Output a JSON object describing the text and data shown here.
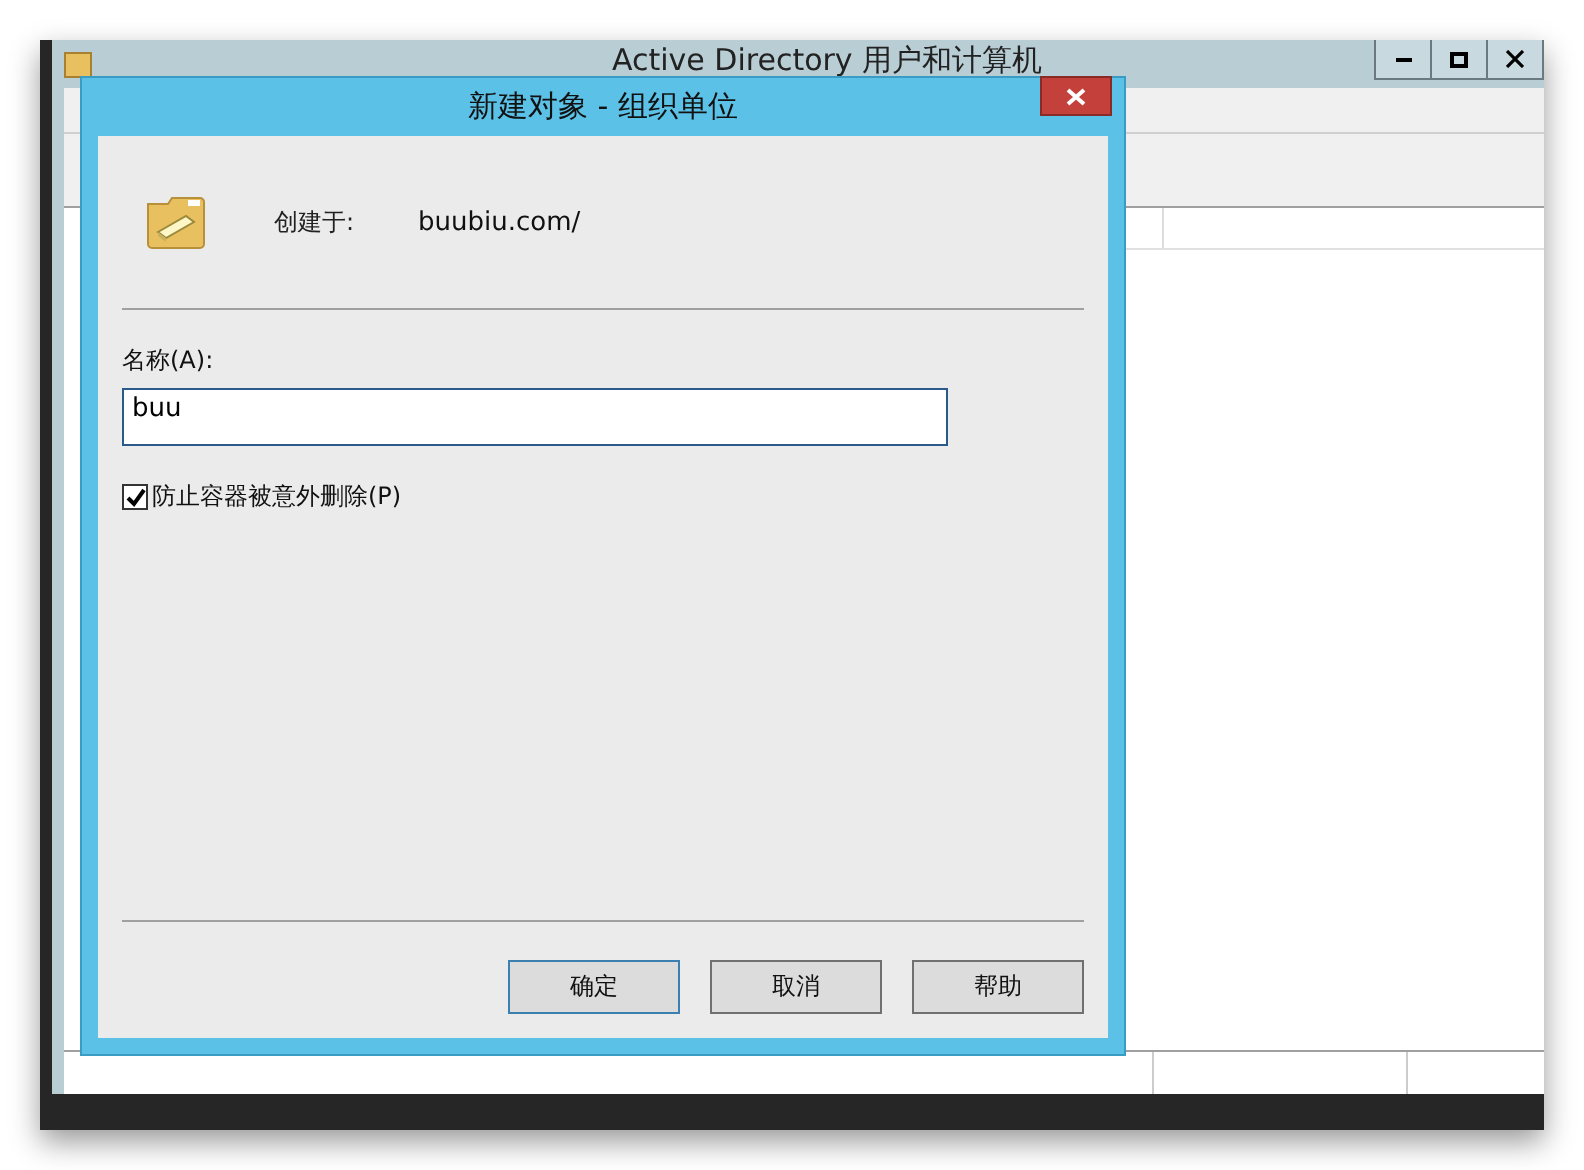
{
  "window": {
    "title": "Active Directory 用户和计算机",
    "controls": [
      {
        "kind": "minimize"
      },
      {
        "kind": "maximize"
      },
      {
        "kind": "close"
      }
    ]
  },
  "dialog": {
    "title": "新建对象 - 组织单位",
    "created_in_label": "创建于:",
    "created_in_value": "buubiu.com/",
    "name_label": "名称(A):",
    "name_value": "buu",
    "protect": {
      "label": "防止容器被意外删除(P)",
      "checked": true
    },
    "buttons": [
      {
        "label": "确定",
        "default": true
      },
      {
        "label": "取消",
        "default": false
      },
      {
        "label": "帮助",
        "default": false
      }
    ]
  }
}
